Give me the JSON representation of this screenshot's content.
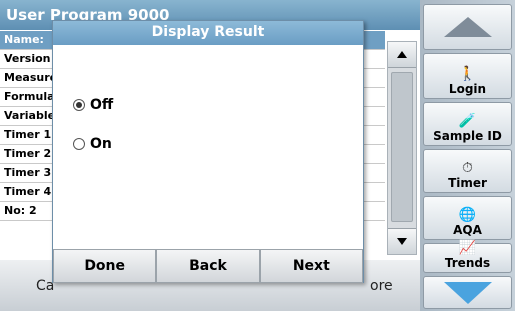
{
  "background": {
    "title": "User Program   9000",
    "rows": [
      {
        "label": "Name:",
        "selected": true
      },
      {
        "label": "Version",
        "selected": false
      },
      {
        "label": "Measurement",
        "selected": false
      },
      {
        "label": "Formula",
        "selected": false
      },
      {
        "label": "Variables",
        "selected": false
      },
      {
        "label": "Timer 1",
        "selected": false
      },
      {
        "label": "Timer 2",
        "selected": false
      },
      {
        "label": "Timer 3",
        "selected": false
      },
      {
        "label": "Timer 4",
        "selected": false
      },
      {
        "label": "No: 2",
        "selected": false
      }
    ],
    "bottom_left": "Ca",
    "bottom_right": "ore"
  },
  "sidebar": {
    "buttons": [
      {
        "label": "Login",
        "icon": "person-icon",
        "glyph": "🚶"
      },
      {
        "label": "Sample ID",
        "icon": "sample-vial-icon",
        "glyph": "🧪"
      },
      {
        "label": "Timer",
        "icon": "timer-icon",
        "glyph": "⏱"
      },
      {
        "label": "AQA",
        "icon": "aqa-globe-icon",
        "glyph": "🌐"
      },
      {
        "label": "Trends",
        "icon": "trends-chart-icon",
        "glyph": "📈"
      }
    ]
  },
  "dialog": {
    "title": "Display Result",
    "options": [
      {
        "label": "Off",
        "checked": true
      },
      {
        "label": "On",
        "checked": false
      }
    ],
    "buttons": {
      "done": "Done",
      "back": "Back",
      "next": "Next"
    }
  },
  "colors": {
    "title_bar": "#6a9dc4",
    "selected_row": "#6f9fc3",
    "scroll_down_arrow": "#4aa3df"
  }
}
